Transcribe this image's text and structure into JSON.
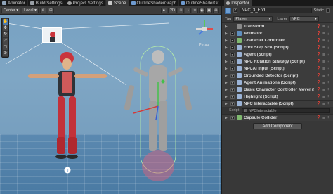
{
  "tabs": [
    {
      "label": "Animator",
      "icon": "animator-icon"
    },
    {
      "label": "Build Settings",
      "icon": "build-icon"
    },
    {
      "label": "Project Settings",
      "icon": "settings-icon"
    },
    {
      "label": "Scene",
      "icon": "scene-icon"
    },
    {
      "label": "OutlineShaderGraph",
      "icon": "graph-icon"
    },
    {
      "label": "OutlineShaderGr",
      "icon": "graph-icon"
    }
  ],
  "inspector_tab": {
    "label": "Inspector"
  },
  "toolbar": {
    "pivot": "Center",
    "space": "Local",
    "mode_2d": "2D"
  },
  "gizmo": {
    "view_label": "Persp"
  },
  "inspector": {
    "object_name": "NPC_3_End",
    "static_label": "Static",
    "tag_label": "Tag",
    "tag_value": "Player",
    "layer_label": "Layer",
    "layer_value": "NPC",
    "components": [
      {
        "label": "Transform",
        "color": "#8a8a8a",
        "checkbox": false
      },
      {
        "label": "Animator",
        "color": "#5f8fbf",
        "checkbox": true
      },
      {
        "label": "Character Controller",
        "color": "#7fb86f",
        "checkbox": true
      },
      {
        "label": "Foot Step SFX (Script)",
        "color": "#9bb3d6",
        "checkbox": true
      },
      {
        "label": "Agent (Script)",
        "color": "#9bb3d6",
        "checkbox": true
      },
      {
        "label": "NPC Rotation Strategy (Script)",
        "color": "#9bb3d6",
        "checkbox": true
      },
      {
        "label": "NPCAI Input (Script)",
        "color": "#9bb3d6",
        "checkbox": true
      },
      {
        "label": "Grounded Detector (Script)",
        "color": "#9bb3d6",
        "checkbox": true
      },
      {
        "label": "Agent Animations (Script)",
        "color": "#9bb3d6",
        "checkbox": true
      },
      {
        "label": "Basic Character Controller Mover (Script)",
        "color": "#9bb3d6",
        "checkbox": true
      },
      {
        "label": "Highlight (Script)",
        "color": "#9bb3d6",
        "checkbox": true
      },
      {
        "label": "NPC Interactable (Script)",
        "color": "#9bb3d6",
        "checkbox": true
      }
    ],
    "script_field_label": "Script",
    "script_field_value": "NPCInteractable",
    "capsule": {
      "label": "Capsule Collider",
      "color": "#7fb86f"
    },
    "add_component_label": "Add Component"
  }
}
